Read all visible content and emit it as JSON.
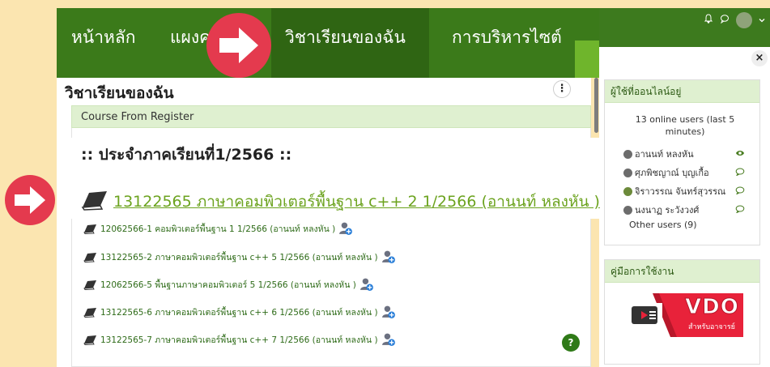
{
  "nav": {
    "home": "หน้าหลัก",
    "dashboard": "แผงค",
    "my_courses": "วิชาเรียนของฉัน",
    "site_admin": "การบริหารไซต์"
  },
  "page": {
    "title": "วิชาเรียนของฉัน",
    "section_header": "Course From Register",
    "term_heading": ":: ประจำภาคเรียนที่1/2566 ::",
    "highlight_course": "13122565 ภาษาคอมพิวเตอร์พื้นฐาน c++ 2 1/2566 (อานนท์ หลงหัน )"
  },
  "courses": [
    "12062566-1 คอมพิวเตอร์พื้นฐาน 1 1/2566 (อานนท์ หลงหัน )",
    "13122565-2 ภาษาคอมพิวเตอร์พื้นฐาน c++ 5 1/2566 (อานนท์ หลงหัน )",
    "12062566-5 พื้นฐานภาษาคอมพิวเตอร์ 5 1/2566 (อานนท์ หลงหัน )",
    "13122565-6 ภาษาคอมพิวเตอร์พื้นฐาน c++ 6 1/2566 (อานนท์ หลงหัน )",
    "13122565-7 ภาษาคอมพิวเตอร์พื้นฐาน c++ 7 1/2566 (อานนท์ หลงหัน )"
  ],
  "online_block": {
    "title": "ผู้ใช้ที่ออนไลน์อยู่",
    "summary": "13 online users (last 5 minutes)",
    "users": [
      {
        "name": "อานนท์ หลงหัน",
        "icon": "eye-icon"
      },
      {
        "name": "ศุภพิชญาณ์ บุญเกื้อ",
        "icon": "message-icon"
      },
      {
        "name": "จิราวรรณ จันทร์สุวรรณ",
        "icon": "message-icon"
      },
      {
        "name": "นงนาฏ ระวังวงศ์",
        "icon": "message-icon"
      }
    ],
    "other": "Other users (9)"
  },
  "manual_block": {
    "title": "คู่มือการใช้งาน",
    "banner_text": "VDO",
    "banner_sub": "สำหรับอาจารย์"
  },
  "icons": {
    "close": "×",
    "more": "⋮",
    "help": "?",
    "bell": "bell-icon",
    "chat": "chat-icon"
  },
  "colors": {
    "nav_green": "#3b7a1a",
    "link_green": "#6ca31f",
    "arrow_red": "#e43a4e",
    "header_tint": "#dff0d0"
  }
}
